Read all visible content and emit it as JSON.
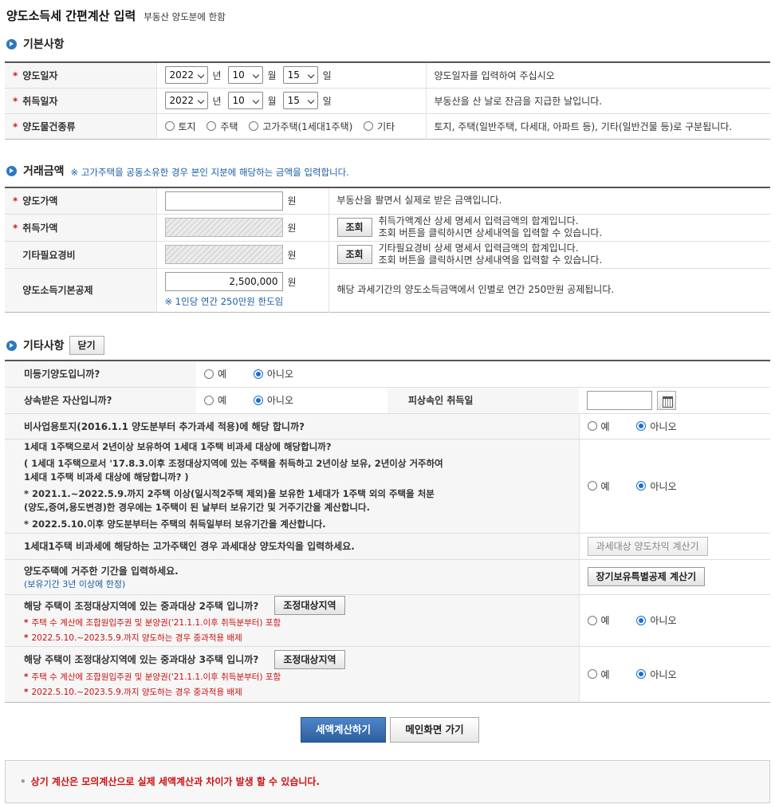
{
  "page": {
    "title": "양도소득세 간편계산 입력",
    "subtitle": "부동산 양도분에 한함"
  },
  "basic": {
    "title": "기본사항",
    "rows": [
      {
        "label": "양도일자",
        "year": "2022",
        "year_unit": "년",
        "month": "10",
        "month_unit": "월",
        "day": "15",
        "day_unit": "일",
        "desc": "양도일자를 입력하여 주십시오"
      },
      {
        "label": "취득일자",
        "year": "2022",
        "year_unit": "년",
        "month": "10",
        "month_unit": "월",
        "day": "15",
        "day_unit": "일",
        "desc": "부동산을 산 날로 잔금을 지급한 날입니다."
      }
    ],
    "type_row": {
      "label": "양도물건종류",
      "options": [
        "토지",
        "주택",
        "고가주택(1세대1주택)",
        "기타"
      ],
      "desc": "토지, 주택(일반주택, 다세대, 아파트 등), 기타(일반건물 등)로 구분됩니다."
    }
  },
  "amount": {
    "title": "거래금액",
    "note": "※ 고가주택을 공동소유한 경우 본인 지분에 해당하는 금액을 입력합니다.",
    "rows": [
      {
        "label": "양도가액",
        "unit": "원",
        "value": "",
        "desc1": "부동산을 팔면서 실제로 받은 금액입니다.",
        "desc2": ""
      },
      {
        "label": "취득가액",
        "unit": "원",
        "value": "",
        "button": "조회",
        "desc1": "취득가액계산 상세 명세서 입력금액의 합계입니다.",
        "desc2": "조회 버튼을 클릭하시면 상세내역을 입력할 수 있습니다."
      },
      {
        "label": "기타필요경비",
        "unit": "원",
        "value": "",
        "button": "조회",
        "desc1": "기타필요경비 상세 명세서 입력금액의 합계입니다.",
        "desc2": "조회 버튼을 클릭하시면 상세내역을 입력할 수 있습니다."
      },
      {
        "label": "양도소득기본공제",
        "unit": "원",
        "value": "2,500,000",
        "note": "※ 1인당 연간 250만원 한도임",
        "desc1": "해당 과세기간의 양도소득금액에서 인별로 연간 250만원 공제됩니다."
      }
    ]
  },
  "other": {
    "title": "기타사항",
    "close_button": "닫기",
    "yes": "예",
    "no": "아니오",
    "q_unregistered": "미등기양도입니까?",
    "q_inherited": "상속받은 자산입니까?",
    "inherit_date_label": "피상속인 취득일",
    "q_nonbusiness": "비사업용토지(2016.1.1 양도분부터 추가과세 적용)에 해당 합니까?",
    "q_one_house": {
      "line1": "1세대 1주택으로서 2년이상 보유하여 1세대 1주택 비과세 대상에 해당합니까?",
      "line2": "( 1세대 1주택으로서 '17.8.3.이후 조정대상지역에 있는 주택을 취득하고 2년이상 보유, 2년이상 거주하여",
      "line3": "1세대 1주택 비과세 대상에 해당합니까? )",
      "line4": "* 2021.1.~2022.5.9.까지 2주택 이상(일시적2주택 제외)을 보유한 1세대가 1주택 외의 주택을 처분",
      "line5": "(양도,증여,용도변경)한 경우에는 1주택이 된 날부터 보유기간 및 거주기간을 계산합니다.",
      "line6": "* 2022.5.10.이후 양도분부터는 주택의 취득일부터 보유기간을 계산합니다."
    },
    "q_luxury": "1세대1주택 비과세에 해당하는 고가주택인 경우 과세대상 양도차익을 입력하세요.",
    "luxury_button": "과세대상 양도차익 계산기",
    "q_residence": "양도주택에 거주한 기간을 입력하세요.",
    "residence_note": "(보유기간 3년 이상에 한정)",
    "residence_button": "장기보유특별공제 계산기",
    "q_2house": "해당 주택이 조정대상지역에 있는 중과대상 2주택 입니까?",
    "q_3house": "해당 주택이 조정대상지역에 있는 중과대상 3주택 입니까?",
    "region_button": "조정대상지역",
    "star": "*",
    "note_count": "주택 수 계산에 조합원입주권 및 분양권('21.1.1.이후 취득분부터) 포함",
    "note_exclude": "2022.5.10.~2023.5.9.까지 양도하는 경우 중과적용 배제"
  },
  "buttons": {
    "calc": "세액계산하기",
    "main": "메인화면 가기"
  },
  "footer": {
    "bullet": "•",
    "text": "상기 계산은 모의계산으로 실제 세액계산과 차이가 발생 할 수 있습니다."
  },
  "colors": {
    "accent": "#2b79c2",
    "required": "#d02020",
    "primary_button": "#2c5f9e",
    "warning": "#cc1111"
  }
}
